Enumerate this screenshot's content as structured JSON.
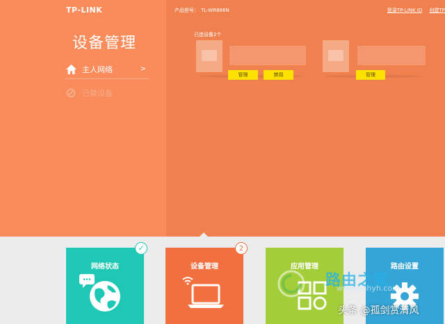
{
  "header": {
    "logo": "TP-LINK",
    "model_label": "产品型号：",
    "model_value": "TL-WR886N",
    "login_link": "登录TP-LINK ID",
    "extra_link": "创建TP"
  },
  "sidebar": {
    "title": "设备管理",
    "items": [
      {
        "label": "主人网络",
        "arrow": ">",
        "icon": "home-icon"
      },
      {
        "label": "已禁设备",
        "icon": "block-icon"
      }
    ]
  },
  "main": {
    "connected_label": "已连设备2个",
    "devices": [
      {
        "buttons": [
          "管理",
          "禁用"
        ]
      },
      {
        "buttons": [
          "管理"
        ]
      }
    ]
  },
  "bottom_nav": [
    {
      "label": "网络状态",
      "color": "#1fc8b4",
      "icon": "globe-icon",
      "badge": "✓"
    },
    {
      "label": "设备管理",
      "color": "#f26f3f",
      "icon": "laptop-wifi-icon",
      "badge": "2"
    },
    {
      "label": "应用管理",
      "color": "#a3cd39",
      "icon": "apps-icon"
    },
    {
      "label": "路由设置",
      "color": "#35a4d6",
      "icon": "gear-icon"
    }
  ],
  "watermark": {
    "text": "路由之家",
    "url": "www.hnhyh.com",
    "signature": "头条 @孤剑赏清风"
  }
}
